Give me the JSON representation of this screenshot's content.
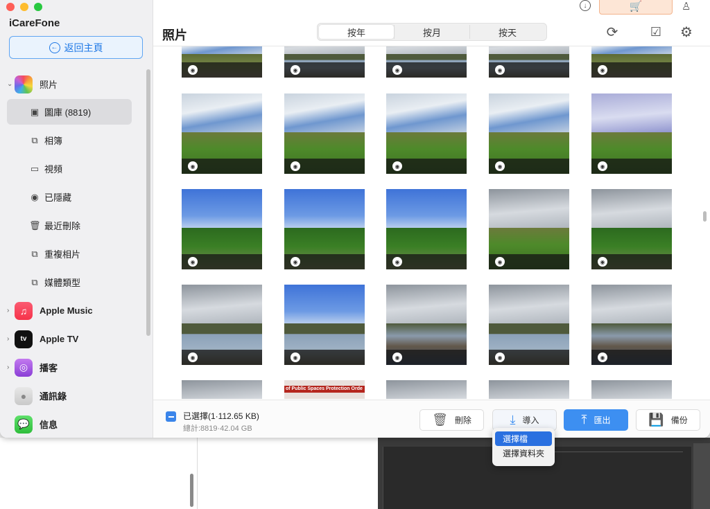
{
  "app": {
    "name": "iCareFone",
    "home_label": "返回主頁"
  },
  "sidebar": {
    "photos": {
      "label": "照片"
    },
    "sub_items": [
      {
        "label": "圖庫 (8819)",
        "icon": "image-icon"
      },
      {
        "label": "相簿",
        "icon": "album-icon"
      },
      {
        "label": "視頻",
        "icon": "video-icon"
      },
      {
        "label": "已隱藏",
        "icon": "eye-icon"
      },
      {
        "label": "最近刪除",
        "icon": "trash-icon"
      },
      {
        "label": "重複相片",
        "icon": "duplicate-icon"
      },
      {
        "label": "媒體類型",
        "icon": "media-type-icon"
      }
    ],
    "apps": [
      {
        "label": "Apple Music"
      },
      {
        "label": "Apple TV"
      },
      {
        "label": "播客"
      },
      {
        "label": "通訊錄"
      },
      {
        "label": "信息"
      }
    ]
  },
  "header": {
    "title": "照片",
    "tabs": [
      "按年",
      "按月",
      "按天"
    ],
    "active_tab": "按年"
  },
  "footer": {
    "selected": "已選擇(1·112.65 KB)",
    "total": "總計:8819·42.04 GB",
    "actions": {
      "delete": "刪除",
      "import": "導入",
      "export": "匯出",
      "backup": "備份"
    }
  },
  "import_menu": {
    "items": [
      "選擇檔",
      "選擇資料夾"
    ],
    "highlighted": "選擇檔"
  },
  "sign_text": "of Public Spaces Protection Orde",
  "colors": {
    "accent": "#3d8ff1",
    "cart": "#f06a1e",
    "selected_bg": "#dcdcdf"
  }
}
